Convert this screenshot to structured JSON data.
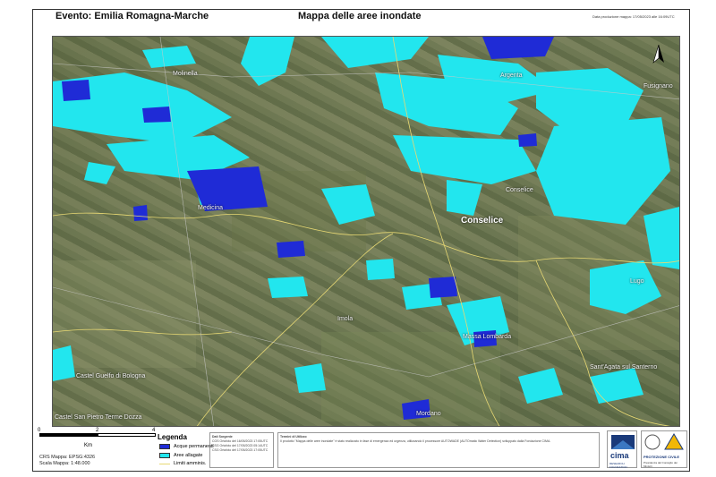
{
  "header": {
    "event_title": "Evento: Emilia Romagna-Marche",
    "map_title": "Mappa delle aree inondate",
    "production_date": "Data produzione mappa: 17/05/2023 alle 16:09UTC"
  },
  "places": {
    "molinella": "Molinella",
    "argenta": "Argenta",
    "medicina": "Medicina",
    "conselice": "Conselice",
    "lugo": "Lugo",
    "imola": "Imola",
    "massa_lombarda": "Massa Lombarda",
    "castel_guelfo": "Castel Guelfo di Bologna",
    "castel_san_pietro": "Castel San Pietro Terme Dozza",
    "santagata": "Sant'Agata sul Santerno",
    "mordano": "Mordano",
    "fusignano": "Fusignano",
    "conselice_small": "Conselice"
  },
  "scale": {
    "ticks": [
      "0",
      "2",
      "4"
    ],
    "unit": "Km",
    "crs": "CRS Mappa: EPSG:4326",
    "scale_text": "Scala Mappa: 1:48.000"
  },
  "legend": {
    "title": "Legenda",
    "items": [
      {
        "label": "Acque permanenti",
        "color": "#1f2bd6"
      },
      {
        "label": "Aree allagate",
        "color": "#22e6ee"
      },
      {
        "label": "Limiti amminis.",
        "color": "#e7d873"
      }
    ]
  },
  "data_source": {
    "title": "Dati Sorgente",
    "lines": [
      "COS Ortofoto del 16/05/2023 17:05UTC",
      "CSG Ortofoto del 17/05/2023 05:14UTC",
      "CSG Ortofoto del 17/05/2023 17:05UTC"
    ]
  },
  "disclaimer": {
    "title": "Termini di Utilizzo",
    "text": "Il prodotto \"Mappa delle aree inondate\" è stato realizzato in fase di emergenza ed urgenza, utilizzando il processore AUTOWADE (AUTOmatic Water Detection) sviluppato dalla Fondazione CIMA."
  },
  "logos": {
    "cima": "cima",
    "cima_sub": "RESEARCH FOUNDATION",
    "pc": "PROTEZIONE CIVILE",
    "pc_sub": "Presidenza del Consiglio dei Ministri"
  },
  "colors": {
    "flooded": "#22e6ee",
    "permanent_water": "#1f2bd6",
    "admin_boundary": "#e7d873"
  },
  "icons": {
    "north_arrow": "north-arrow-icon"
  }
}
